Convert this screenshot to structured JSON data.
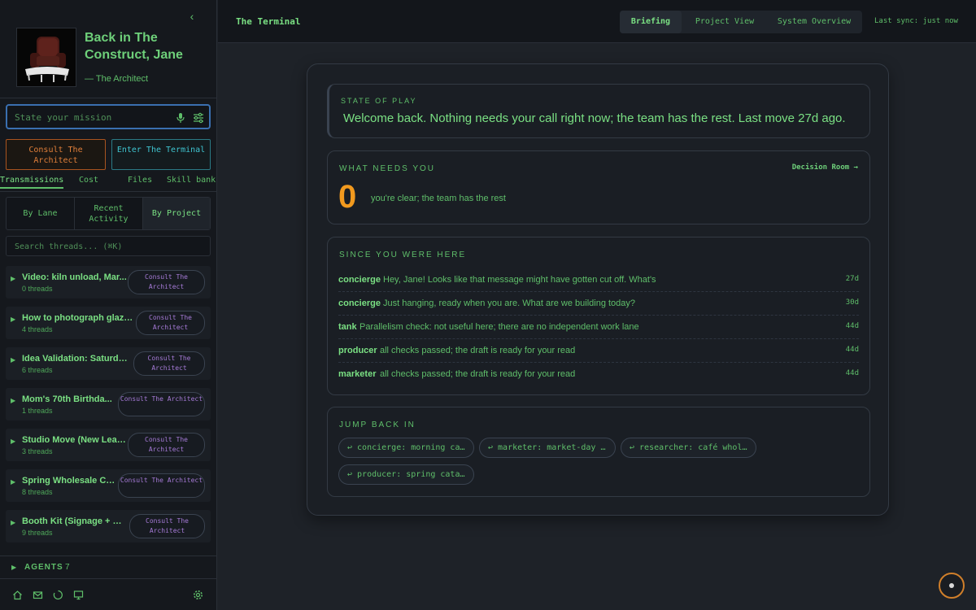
{
  "sidebar": {
    "greeting": "Back in The Construct, Jane",
    "subtitle": "— The Architect",
    "mission_placeholder": "State your mission",
    "consult_button": "Consult The Architect",
    "enter_button": "Enter The Terminal",
    "tabs": [
      "Transmissions",
      "Cost",
      "Files",
      "Skill bank"
    ],
    "view_options": [
      "By Lane",
      "Recent Activity",
      "By Project"
    ],
    "search_placeholder": "Search threads... (⌘K)",
    "threads": [
      {
        "title": "Video: kiln unload, Mar...",
        "count": "0 threads",
        "action": "Consult The Architect"
      },
      {
        "title": "How to photograph glaze...",
        "count": "4 threads",
        "action": "Consult The Architect"
      },
      {
        "title": "Idea Validation: Saturda...",
        "count": "6 threads",
        "action": "Consult The Architect"
      },
      {
        "title": "Mom's 70th Birthda...",
        "count": "1 threads",
        "action": "Consult The Architect"
      },
      {
        "title": "Studio Move (New Lease...",
        "count": "3 threads",
        "action": "Consult The Architect"
      },
      {
        "title": "Spring Wholesale Ca...",
        "count": "8 threads",
        "action": "Consult The Architect"
      },
      {
        "title": "Booth Kit (Signage + Pr...",
        "count": "9 threads",
        "action": "Consult The Architect"
      }
    ],
    "agents_label": "AGENTS",
    "agents_count": "7"
  },
  "topbar": {
    "title": "The Terminal",
    "tabs": [
      "Briefing",
      "Project View",
      "System Overview"
    ],
    "sync": "Last sync: just now"
  },
  "main": {
    "state_label": "STATE OF PLAY",
    "state_message": "Welcome back. Nothing needs your call right now; the team has the rest. Last move 27d ago.",
    "needs_label": "WHAT NEEDS YOU",
    "decision_link": "Decision Room →",
    "needs_count": "0",
    "needs_text": "you're clear; the team has the rest",
    "since_label": "SINCE YOU WERE HERE",
    "feed": [
      {
        "who": "concierge",
        "text": "Hey, Jane! Looks like that message might have gotten cut off. What's",
        "age": "27d"
      },
      {
        "who": "concierge",
        "text": "Just hanging, ready when you are. What are we building today?",
        "age": "30d"
      },
      {
        "who": "tank",
        "text": "Parallelism check: not useful here; there are no independent work lane",
        "age": "44d"
      },
      {
        "who": "producer",
        "text": "all checks passed; the draft is ready for your read",
        "age": "44d"
      },
      {
        "who": "marketer",
        "text": "all checks passed; the draft is ready for your read",
        "age": "44d"
      }
    ],
    "jump_label": "JUMP BACK IN",
    "chips": [
      "↩ concierge: morning ca…",
      "↩ marketer: market-day …",
      "↩ researcher: café whol…",
      "↩ producer: spring cata…"
    ]
  },
  "colors": {
    "accent_green": "#7ae083",
    "accent_orange": "#f29a1e",
    "accent_cyan": "#3fc4d0",
    "accent_purple": "#a57ad6"
  }
}
